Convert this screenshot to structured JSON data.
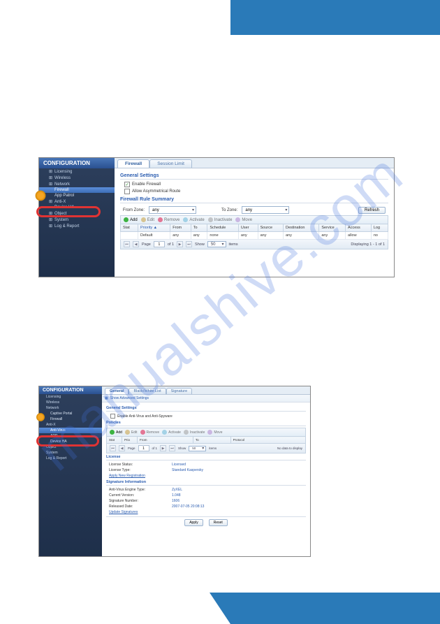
{
  "watermark": "manualshive.com",
  "screenshot1": {
    "sidebar": {
      "title": "CONFIGURATION",
      "items": [
        {
          "label": "Licensing",
          "level": 1
        },
        {
          "label": "Wireless",
          "level": 1
        },
        {
          "label": "Network",
          "level": 1
        },
        {
          "label": "Firewall",
          "level": 2,
          "active": true,
          "circled": true
        },
        {
          "label": "App Patrol",
          "level": 2
        },
        {
          "label": "Anti-X",
          "level": 1
        },
        {
          "label": "Device HA",
          "level": 2
        },
        {
          "label": "Object",
          "level": 1
        },
        {
          "label": "System",
          "level": 1
        },
        {
          "label": "Log & Report",
          "level": 1
        }
      ]
    },
    "tabs": [
      {
        "label": "Firewall",
        "active": true
      },
      {
        "label": "Session Limit",
        "active": false
      }
    ],
    "general": {
      "title": "General Settings",
      "enable": {
        "label": "Enable Firewall",
        "checked": true
      },
      "asym": {
        "label": "Allow Asymmetrical Route",
        "checked": false
      }
    },
    "rules": {
      "title": "Firewall Rule Summary",
      "from_label": "From Zone:",
      "from_value": "any",
      "to_label": "To Zone:",
      "to_value": "any",
      "refresh": "Refresh"
    },
    "toolbar": {
      "add": "Add",
      "edit": "Edit",
      "remove": "Remove",
      "activate": "Activate",
      "inactivate": "Inactivate",
      "move": "Move"
    },
    "grid": {
      "headers": [
        "Stat",
        "Priority",
        "From",
        "To",
        "Schedule",
        "User",
        "Source",
        "Destination",
        "Service",
        "Access",
        "Log"
      ],
      "row": [
        "",
        "Default",
        "any",
        "any",
        "none",
        "any",
        "any",
        "any",
        "any",
        "allow",
        "no"
      ]
    },
    "pager": {
      "page_label": "Page",
      "page_value": "1",
      "of": "of 1",
      "show_label": "Show",
      "show_value": "50",
      "items": "items",
      "display": "Displaying 1 - 1 of 1"
    }
  },
  "screenshot2": {
    "sidebar": {
      "title": "CONFIGURATION",
      "items": [
        {
          "label": "Licensing",
          "level": 1
        },
        {
          "label": "Wireless",
          "level": 1
        },
        {
          "label": "Network",
          "level": 1
        },
        {
          "label": "Captive Portal",
          "level": 2
        },
        {
          "label": "Firewall",
          "level": 2
        },
        {
          "label": "Anti-X",
          "level": 1
        },
        {
          "label": "Anti-Virus",
          "level": 2,
          "active": true,
          "circled": true
        },
        {
          "label": "ADP",
          "level": 2
        },
        {
          "label": "Device HA",
          "level": 2
        },
        {
          "label": "Object",
          "level": 1
        },
        {
          "label": "System",
          "level": 1
        },
        {
          "label": "Log & Report",
          "level": 1
        }
      ]
    },
    "tabs": [
      {
        "label": "General",
        "active": true
      },
      {
        "label": "Black/White List",
        "active": false
      },
      {
        "label": "Signature",
        "active": false
      }
    ],
    "show_advanced": "Show Advanced Settings",
    "general": {
      "title": "General Settings",
      "enable": {
        "label": "Enable Anti-Virus and Anti-Spyware",
        "checked": false
      }
    },
    "policies": {
      "title": "Policies"
    },
    "toolbar": {
      "add": "Add",
      "edit": "Edit",
      "remove": "Remove",
      "activate": "Activate",
      "inactivate": "Inactivate",
      "move": "Move"
    },
    "grid": {
      "headers": [
        "Stat",
        "Prio",
        "From",
        "To",
        "Protocol"
      ],
      "empty": "No data to display"
    },
    "pager": {
      "page_label": "Page",
      "page_value": "1",
      "of": "of 1",
      "show_label": "Show",
      "show_value": "50",
      "items": "items"
    },
    "license": {
      "title": "License",
      "status_label": "License Status:",
      "status_value": "Licensed",
      "type_label": "License Type:",
      "type_value": "Standard Kaspersky",
      "apply_link": "Apply New Registration"
    },
    "sig": {
      "title": "Signature Information",
      "engine_label": "Anti-Virus Engine Type:",
      "engine_value": "ZyXEL",
      "ver_label": "Current Version:",
      "ver_value": "1.048",
      "num_label": "Signature Number:",
      "num_value": "1606",
      "date_label": "Released Date:",
      "date_value": "2007-07-05 20:08:13",
      "update_link": "Update Signatures"
    },
    "footer": {
      "apply": "Apply",
      "reset": "Reset"
    }
  }
}
